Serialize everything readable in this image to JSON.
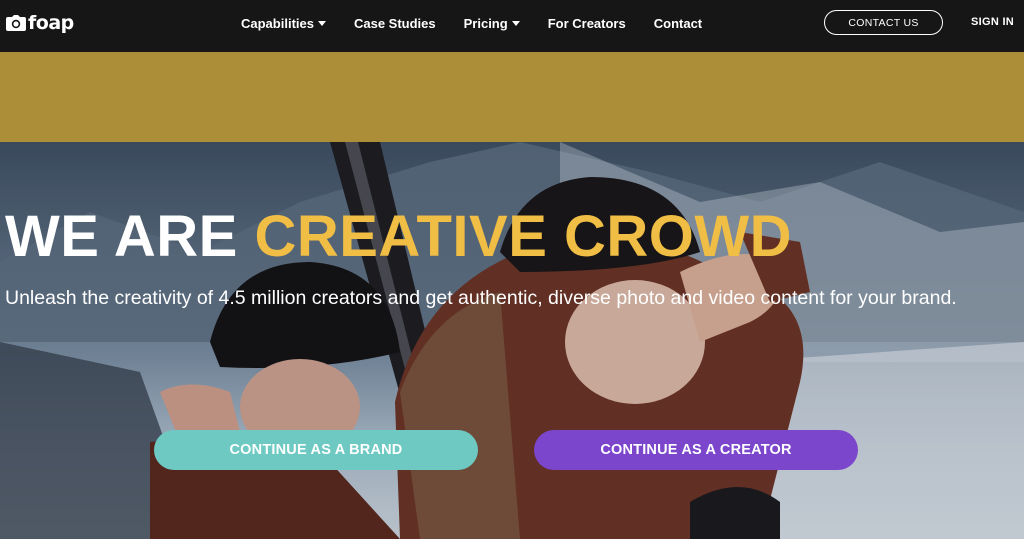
{
  "brand": {
    "name": "foap"
  },
  "nav": {
    "items": [
      {
        "label": "Capabilities",
        "dropdown": true
      },
      {
        "label": "Case Studies",
        "dropdown": false
      },
      {
        "label": "Pricing",
        "dropdown": true
      },
      {
        "label": "For Creators",
        "dropdown": false
      },
      {
        "label": "Contact",
        "dropdown": false
      }
    ],
    "contact_button": "CONTACT US",
    "sign_in": "SIGN IN"
  },
  "hero": {
    "headline_white": "WE ARE ",
    "headline_gold": "CREATIVE CROWD",
    "subtitle": "Unleash the creativity of 4.5 million creators and get authentic, diverse photo and video content for your brand.",
    "cta_brand": "CONTINUE AS A BRAND",
    "cta_creator": "CONTINUE AS A CREATOR"
  },
  "colors": {
    "nav_bg": "#161616",
    "banner": "#ac8d38",
    "headline_accent": "#f0bd45",
    "cta_brand": "#6dc9c2",
    "cta_creator": "#7b45cc"
  },
  "icons": {
    "logo": "camera-icon",
    "dropdown": "caret-down-icon"
  }
}
